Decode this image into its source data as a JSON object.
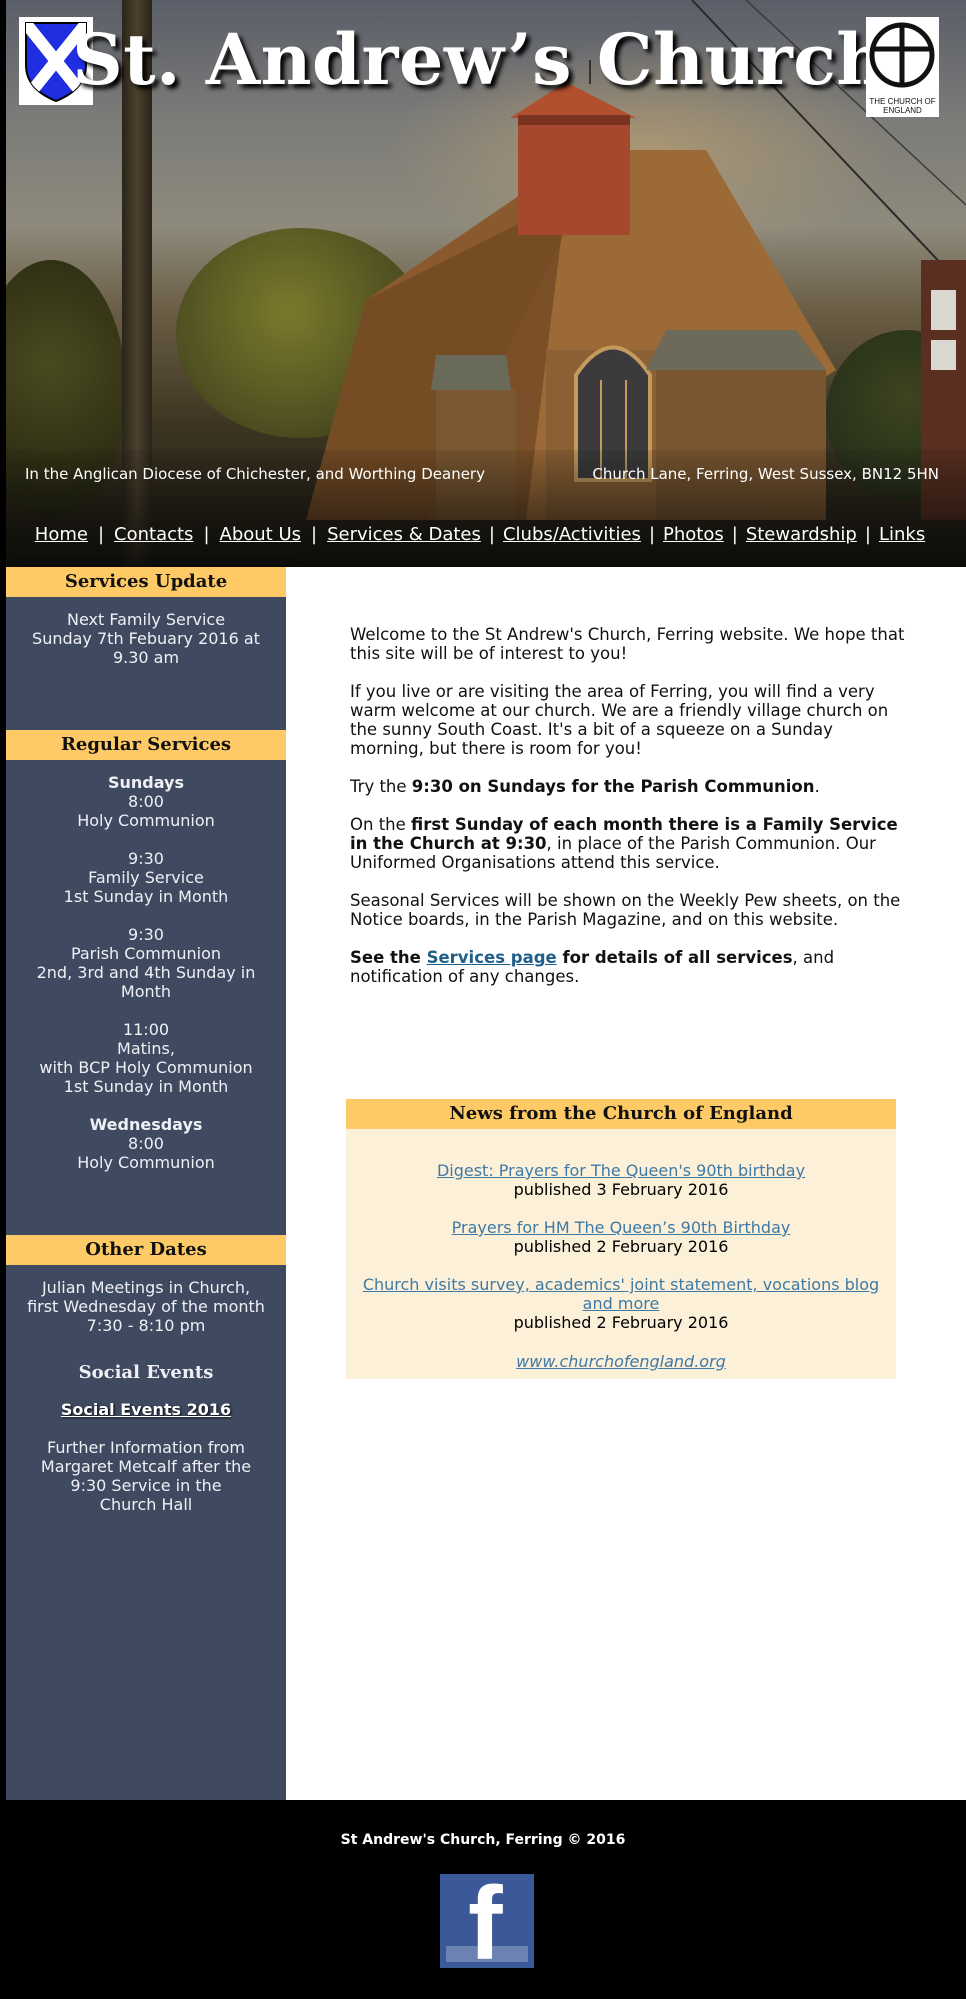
{
  "header": {
    "title": "St. Andrew’s Church",
    "diocese": "In the Anglican Diocese of Chichester, and Worthing Deanery",
    "address": "Church Lane, Ferring, West Sussex, BN12 5HN",
    "coe_logo_text": "THE CHURCH OF ENGLAND"
  },
  "nav": {
    "items": [
      "Home",
      "Contacts",
      "About Us",
      "Services & Dates",
      "Clubs/Activities",
      "Photos",
      "Stewardship",
      "Links"
    ],
    "separator": "|"
  },
  "sidebar": {
    "services_update": {
      "heading": "Services Update",
      "line1": "Next Family Service",
      "line2": "Sunday 7th Febuary 2016 at 9.30 am"
    },
    "regular_services": {
      "heading": "Regular Services",
      "sundays_label": "Sundays",
      "s1_time": "8:00",
      "s1_name": "Holy Communion",
      "s2_time": "9:30",
      "s2_name": "Family Service",
      "s2_note": "1st Sunday in Month",
      "s3_time": "9:30",
      "s3_name": "Parish Communion",
      "s3_note": "2nd, 3rd and 4th Sunday in Month",
      "s4_time": "11:00",
      "s4_name": "Matins,",
      "s4_extra": "with BCP Holy Communion",
      "s4_note": "1st Sunday in Month",
      "wednesdays_label": "Wednesdays",
      "w1_time": "8:00",
      "w1_name": "Holy Communion"
    },
    "other_dates": {
      "heading": "Other Dates",
      "julian_line1": "Julian Meetings in Church,",
      "julian_line2": "first Wednesday of the month",
      "julian_time": "7:30 - 8:10 pm",
      "social_heading": "Social Events",
      "social_link": "Social Events 2016",
      "further_info": "Further Information from Margaret Metcalf after the 9:30 Service in the",
      "church_hall": "Church Hall"
    }
  },
  "main": {
    "p1": "Welcome to the St Andrew's Church, Ferring website. We hope that this site will be of interest to you!",
    "p2": "If you live or are visiting the area of Ferring, you will find a very warm welcome at our church. We are a friendly village church on the sunny South Coast. It's a bit of a squeeze on a Sunday morning, but there is room for you!",
    "p3_prefix": "Try the ",
    "p3_bold": "9:30 on Sundays for the Parish Communion",
    "p3_suffix": ".",
    "p4_prefix": "On the ",
    "p4_bold": "first Sunday of each month there is a Family Service in the Church at 9:30",
    "p4_suffix": ", in place of the Parish Communion. Our Uniformed Organisations attend this service.",
    "p5": "Seasonal Services will be shown on the Weekly Pew sheets, on the Notice boards, in the Parish Magazine, and on this website.",
    "p6_prefix": "See the ",
    "p6_link": "Services page",
    "p6_bold": " for details of all services",
    "p6_suffix": ", and notification of any changes."
  },
  "news": {
    "heading": "News from the Church of England",
    "items": [
      {
        "title": "Digest: Prayers for The Queen's 90th birthday",
        "date": "published 3 February 2016"
      },
      {
        "title": "Prayers for HM The Queen’s 90th Birthday",
        "date": "published 2 February 2016"
      },
      {
        "title": "Church visits survey, academics' joint statement, vocations blog and more",
        "date": "published 2 February 2016"
      }
    ],
    "site_link": "www.churchofengland.org"
  },
  "footer": {
    "copyright": "St Andrew's Church, Ferring © 2016"
  },
  "colors": {
    "sidebar_bg": "#3f4a61",
    "heading_bar": "#fdca66",
    "news_bg": "#fcf0d9",
    "link": "#3e7aa5",
    "facebook": "#3b5998"
  }
}
